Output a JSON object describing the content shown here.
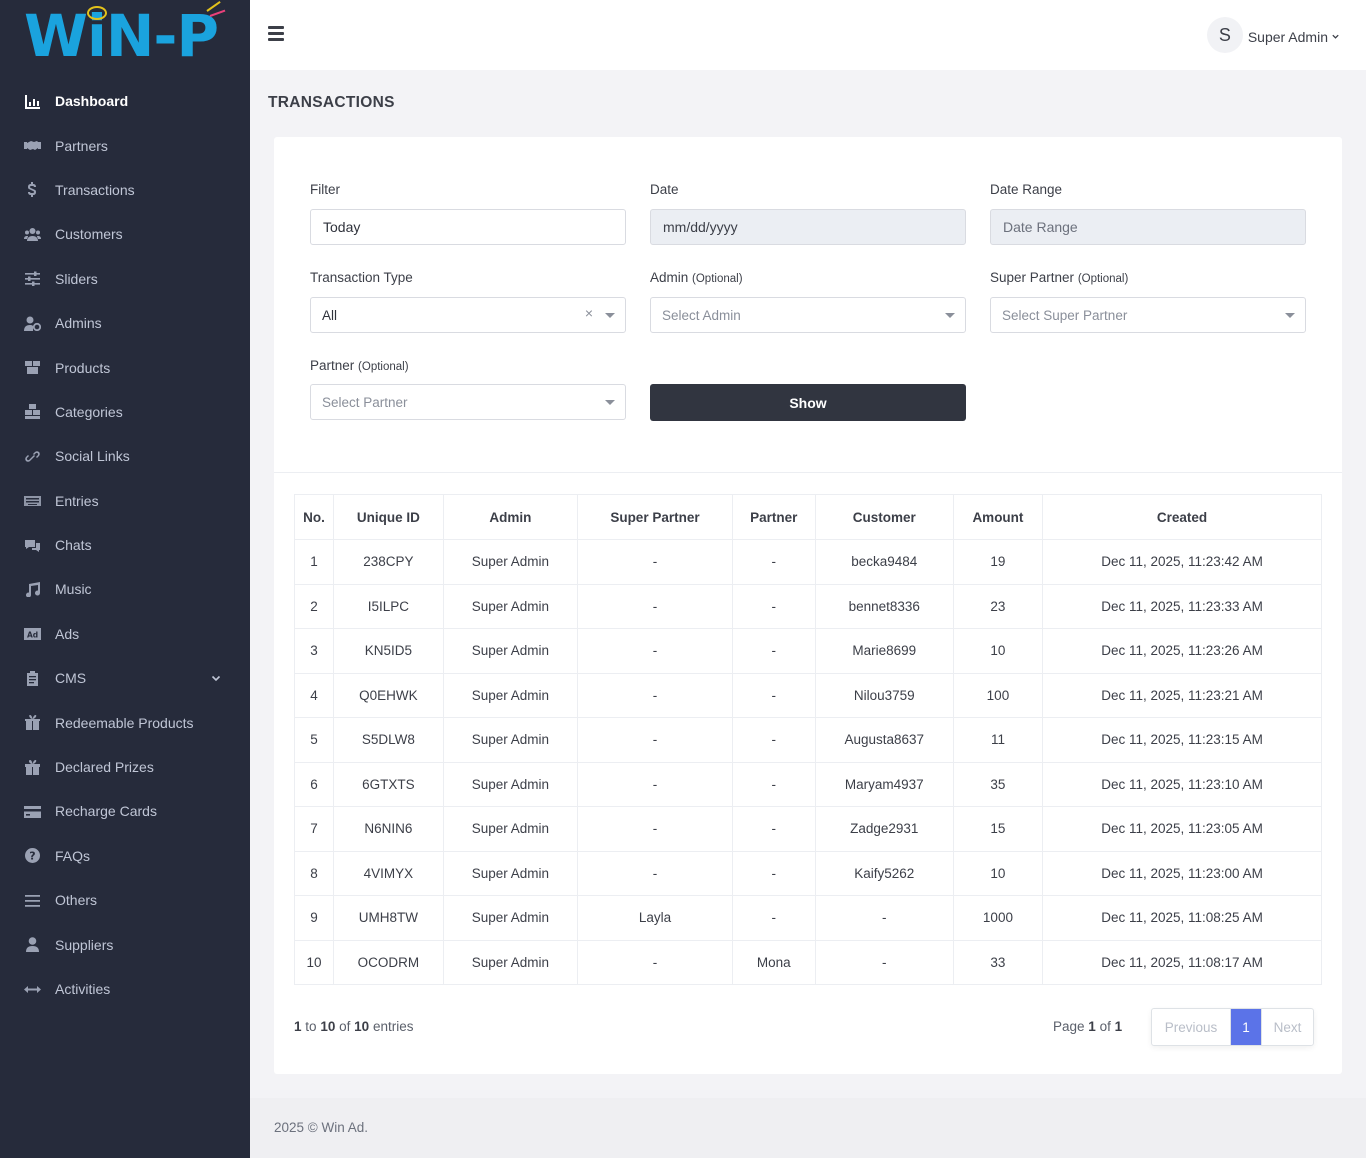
{
  "brand": {
    "logo_text": "WiN-P",
    "accent": "#1aa3de"
  },
  "sidebar": {
    "items": [
      {
        "label": "Dashboard",
        "icon": "bar-chart-icon",
        "active": true
      },
      {
        "label": "Partners",
        "icon": "handshake-icon"
      },
      {
        "label": "Transactions",
        "icon": "dollar-icon"
      },
      {
        "label": "Customers",
        "icon": "users-icon"
      },
      {
        "label": "Sliders",
        "icon": "sliders-icon"
      },
      {
        "label": "Admins",
        "icon": "user-cog-icon"
      },
      {
        "label": "Products",
        "icon": "boxes-icon"
      },
      {
        "label": "Categories",
        "icon": "cubes-icon"
      },
      {
        "label": "Social Links",
        "icon": "link-icon"
      },
      {
        "label": "Entries",
        "icon": "keyboard-icon"
      },
      {
        "label": "Chats",
        "icon": "comments-icon"
      },
      {
        "label": "Music",
        "icon": "music-icon"
      },
      {
        "label": "Ads",
        "icon": "ad-icon"
      },
      {
        "label": "CMS",
        "icon": "clipboard-icon",
        "has_submenu": true
      },
      {
        "label": "Redeemable Products",
        "icon": "gifts-icon"
      },
      {
        "label": "Declared Prizes",
        "icon": "gift-icon"
      },
      {
        "label": "Recharge Cards",
        "icon": "credit-card-icon"
      },
      {
        "label": "FAQs",
        "icon": "question-circle-icon"
      },
      {
        "label": "Others",
        "icon": "list-icon"
      },
      {
        "label": "Suppliers",
        "icon": "user-tie-icon"
      },
      {
        "label": "Activities",
        "icon": "arrows-h-icon"
      }
    ]
  },
  "header": {
    "avatar_letter": "S",
    "user_name": "Super Admin"
  },
  "page": {
    "title": "TRANSACTIONS"
  },
  "filters": {
    "filter": {
      "label": "Filter",
      "value": "Today"
    },
    "date": {
      "label": "Date",
      "placeholder": "mm/dd/yyyy"
    },
    "date_range": {
      "label": "Date Range",
      "placeholder": "Date Range"
    },
    "transaction_type": {
      "label": "Transaction Type",
      "value": "All",
      "clear": "×"
    },
    "admin": {
      "label": "Admin",
      "optional": "(Optional)",
      "placeholder": "Select Admin"
    },
    "super_partner": {
      "label": "Super Partner",
      "optional": "(Optional)",
      "placeholder": "Select Super Partner"
    },
    "partner": {
      "label": "Partner",
      "optional": "(Optional)",
      "placeholder": "Select Partner"
    },
    "show_label": "Show"
  },
  "table": {
    "columns": [
      "No.",
      "Unique ID",
      "Admin",
      "Super Partner",
      "Partner",
      "Customer",
      "Amount",
      "Created"
    ],
    "rows": [
      [
        "1",
        "238CPY",
        "Super Admin",
        "-",
        "-",
        "becka9484",
        "19",
        "Dec 11, 2025, 11:23:42 AM"
      ],
      [
        "2",
        "I5ILPC",
        "Super Admin",
        "-",
        "-",
        "bennet8336",
        "23",
        "Dec 11, 2025, 11:23:33 AM"
      ],
      [
        "3",
        "KN5ID5",
        "Super Admin",
        "-",
        "-",
        "Marie8699",
        "10",
        "Dec 11, 2025, 11:23:26 AM"
      ],
      [
        "4",
        "Q0EHWK",
        "Super Admin",
        "-",
        "-",
        "Nilou3759",
        "100",
        "Dec 11, 2025, 11:23:21 AM"
      ],
      [
        "5",
        "S5DLW8",
        "Super Admin",
        "-",
        "-",
        "Augusta8637",
        "11",
        "Dec 11, 2025, 11:23:15 AM"
      ],
      [
        "6",
        "6GTXTS",
        "Super Admin",
        "-",
        "-",
        "Maryam4937",
        "35",
        "Dec 11, 2025, 11:23:10 AM"
      ],
      [
        "7",
        "N6NIN6",
        "Super Admin",
        "-",
        "-",
        "Zadge2931",
        "15",
        "Dec 11, 2025, 11:23:05 AM"
      ],
      [
        "8",
        "4VIMYX",
        "Super Admin",
        "-",
        "-",
        "Kaify5262",
        "10",
        "Dec 11, 2025, 11:23:00 AM"
      ],
      [
        "9",
        "UMH8TW",
        "Super Admin",
        "Layla",
        "-",
        "-",
        "1000",
        "Dec 11, 2025, 11:08:25 AM"
      ],
      [
        "10",
        "OCODRM",
        "Super Admin",
        "-",
        "Mona",
        "-",
        "33",
        "Dec 11, 2025, 11:08:17 AM"
      ]
    ]
  },
  "pagination": {
    "start": "1",
    "to": "to",
    "end": "10",
    "of": "of",
    "total": "10",
    "entries_word": "entries",
    "page_word": "Page",
    "current": "1",
    "pages": "1",
    "previous": "Previous",
    "page_button": "1",
    "next": "Next",
    "active_color": "#5b73e8"
  },
  "footer": {
    "text": "2025 © Win Ad."
  }
}
